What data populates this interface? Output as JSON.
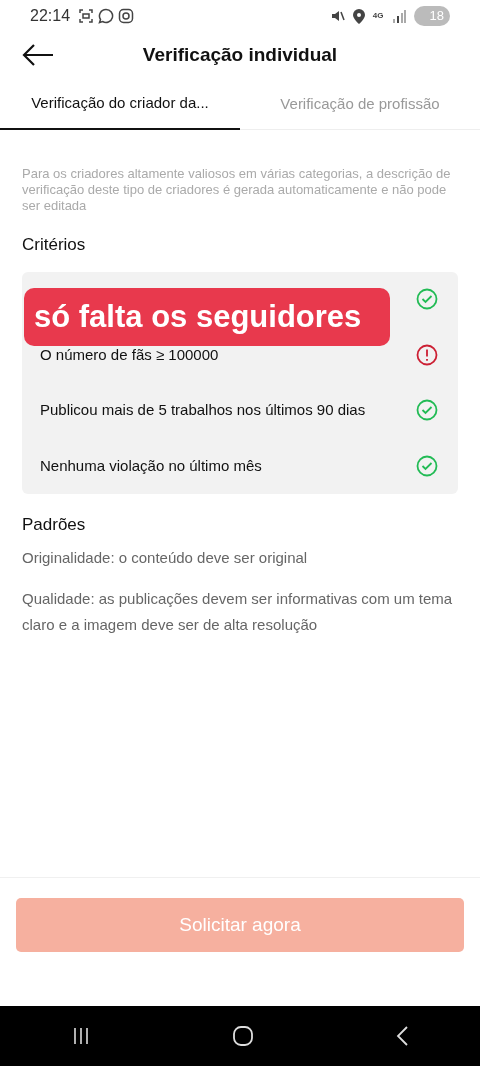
{
  "status_bar": {
    "time": "22:14",
    "battery": "18",
    "network": "4G"
  },
  "header": {
    "title": "Verificação individual"
  },
  "tabs": [
    {
      "label": "Verificação do criador da...",
      "selected": true
    },
    {
      "label": "Verificação de profissão",
      "selected": false
    }
  ],
  "description": "Para os criadores altamente valiosos em várias categorias, a descrição de verificação deste tipo de criadores é gerada automaticamente e não pode ser editada",
  "criteria": {
    "title": "Critérios",
    "items": [
      {
        "met": true
      },
      {
        "text": "O número de fãs ≥ 100000",
        "met": false
      },
      {
        "text": "Publicou mais de 5 trabalhos nos últimos 90 dias",
        "met": true
      },
      {
        "text": "Nenhuma violação no último mês",
        "met": true
      }
    ]
  },
  "overlay_caption": "só falta os seguidores",
  "standards": {
    "title": "Padrões",
    "items": [
      "Originalidade: o conteúdo deve ser original",
      "Qualidade: as publicações devem ser informativas com um tema claro e a imagem deve ser de alta resolução"
    ]
  },
  "apply_button": {
    "label": "Solicitar agora",
    "disabled": true
  }
}
